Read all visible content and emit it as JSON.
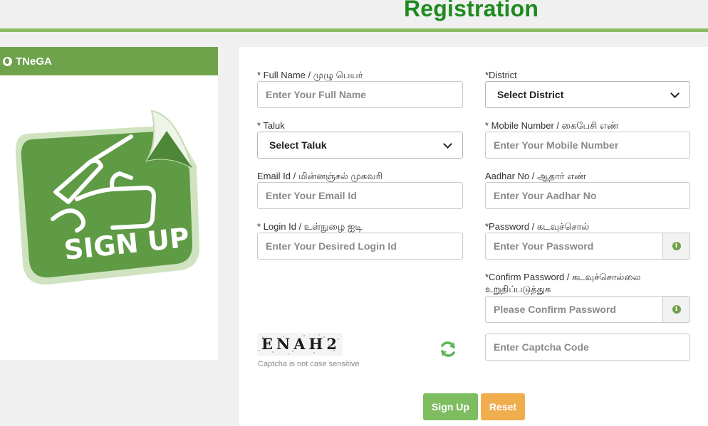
{
  "header": {
    "title": "Registration"
  },
  "sidebar": {
    "brand": "TNeGA",
    "icon": "globe-icon",
    "art_label": "SIGN UP",
    "colors": {
      "header": "#6ea24b",
      "art": "#5f9a45"
    }
  },
  "form": {
    "full_name": {
      "label": "* Full Name / முழு பெயர்",
      "placeholder": "Enter Your Full Name"
    },
    "district": {
      "label": "*District",
      "selected": "Select District"
    },
    "taluk": {
      "label": "* Taluk",
      "selected": "Select Taluk"
    },
    "mobile": {
      "label": "* Mobile Number / கைபேசி எண்",
      "placeholder": "Enter Your Mobile Number"
    },
    "email": {
      "label": "Email Id / மின்னஞ்சல் முகவரி",
      "placeholder": "Enter Your Email Id"
    },
    "aadhar": {
      "label": "Aadhar No / ஆதார் எண்",
      "placeholder": "Enter Your Aadhar No"
    },
    "login": {
      "label": "* Login Id / உள்நுழை ஐடி",
      "placeholder": "Enter Your Desired Login Id"
    },
    "password": {
      "label": "*Password / கடவுச்சொல்",
      "placeholder": "Enter Your Password",
      "addon_icon": "info-icon"
    },
    "confirm_password": {
      "label_line1": "*Confirm Password / கடவுச்சொல்லை",
      "label_line2": "உறுதிப்படுத்துக",
      "placeholder": "Please Confirm Password",
      "addon_icon": "info-icon"
    },
    "captcha": {
      "image_text": "ENAH2",
      "note": "Captcha is not case sensitive",
      "placeholder": "Enter Captcha Code",
      "refresh_icon": "refresh-icon"
    },
    "buttons": {
      "signup": "Sign Up",
      "reset": "Reset"
    }
  },
  "colors": {
    "title_green": "#1e8a1e",
    "rule_green": "#8dbb63",
    "signup_btn": "#7dbd60",
    "reset_btn": "#f0ad4e"
  }
}
